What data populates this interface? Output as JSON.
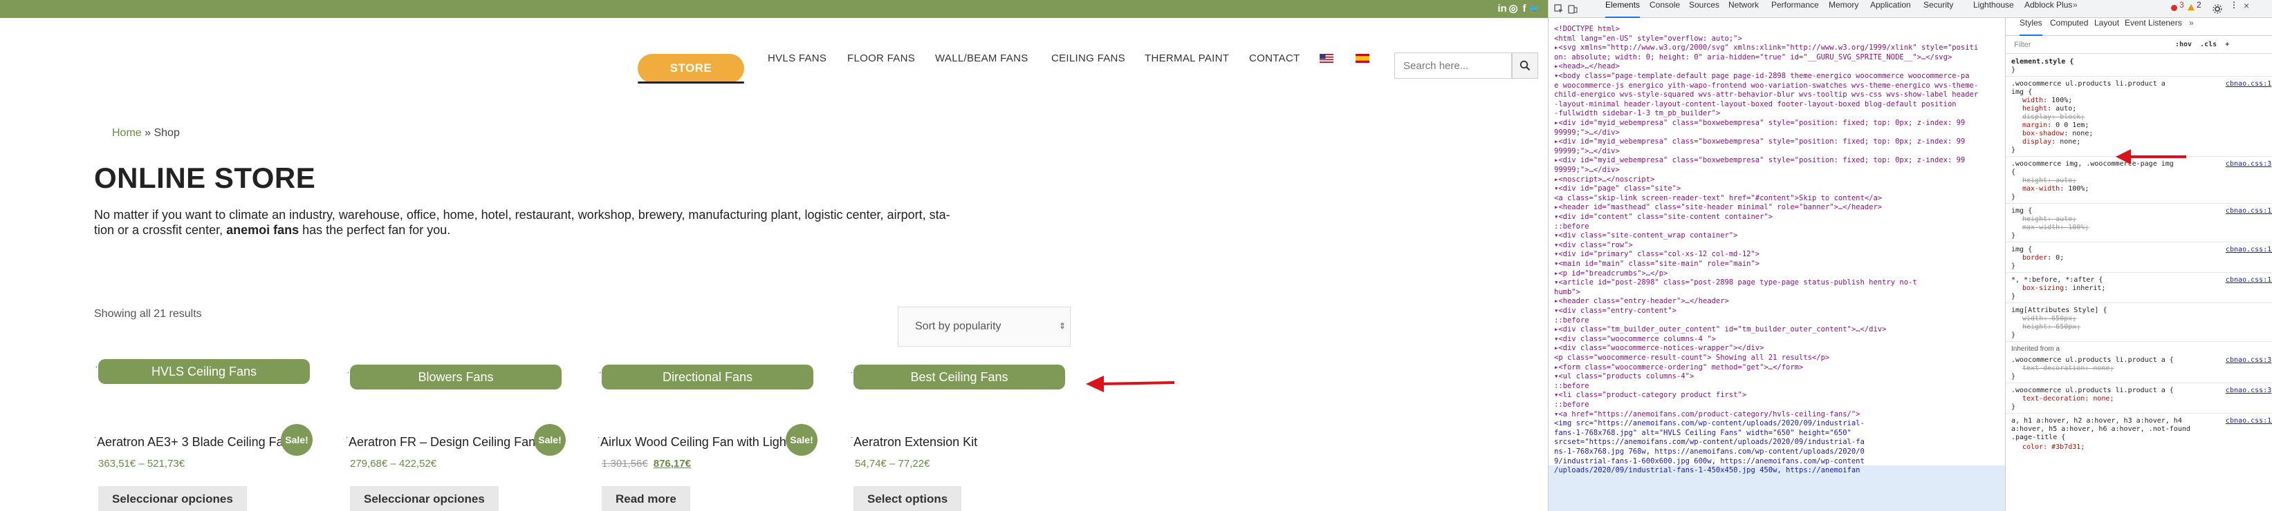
{
  "site": {
    "social": [
      "in",
      "◎",
      "f",
      "🐦"
    ],
    "nav": {
      "store": "STORE",
      "items": [
        "HVLS FANS",
        "FLOOR FANS",
        "WALL/BEAM FANS",
        "CEILING FANS",
        "THERMAL PAINT",
        "CONTACT"
      ],
      "search_placeholder": "Search here..."
    },
    "breadcrumb": {
      "home": "Home",
      "sep": " » ",
      "current": "Shop"
    },
    "title": "ONLINE STORE",
    "intro_1": "No matter if you want to climate an industry, warehouse, office, home, hotel, restaurant, workshop, brewery, manufacturing plant, logistic center, airport, sta-",
    "intro_2a": "tion or a crossfit center, ",
    "intro_brand": "anemoi fans",
    "intro_2b": " has the perfect fan for you.",
    "result_count": "Showing all 21 results",
    "sort": "Sort by popularity",
    "categories": [
      "HVLS Ceiling Fans",
      "Blowers Fans",
      "Directional Fans",
      "Best Ceiling Fans"
    ],
    "products": [
      {
        "name": "Aeratron AE3+ 3 Blade Ceiling Fan",
        "sale": "Sale!",
        "price": "363,51€ – 521,73€",
        "button": "Seleccionar opciones"
      },
      {
        "name": "Aeratron FR – Design Ceiling Fan",
        "sale": "Sale!",
        "price": "279,68€ – 422,52€",
        "button": "Seleccionar opciones"
      },
      {
        "name": "Airlux Wood Ceiling Fan with Light",
        "sale": "Sale!",
        "old_price": "1.301,56€",
        "price": "876,17€",
        "button": "Read more"
      },
      {
        "name": "Aeratron Extension Kit",
        "price": "54,74€ – 77,22€",
        "button": "Select options"
      }
    ]
  },
  "devtools": {
    "tabs": [
      "Elements",
      "Console",
      "Sources",
      "Network",
      "Performance",
      "Memory",
      "Application",
      "Security",
      "Lighthouse",
      "Adblock Plus"
    ],
    "badges": {
      "errors": "3",
      "warnings": "2"
    },
    "elements": [
      "<!DOCTYPE html>",
      "<html lang=\"en-US\" style=\"overflow: auto;\">",
      "▸<svg xmlns=\"http://www.w3.org/2000/svg\" xmlns:xlink=\"http://www.w3.org/1999/xlink\" style=\"positi",
      "on: absolute; width: 0; height: 0\" aria-hidden=\"true\" id=\"__GURU_SVG_SPRITE_NODE__\">…</svg>",
      "▸<head>…</head>",
      "▾<body class=\"page-template-default page page-id-2898 theme-energico woocommerce woocommerce-pa",
      "e woocommerce-js energico yith-wapo-frontend woo-variation-swatches wvs-theme-energico wvs-theme-",
      "child-energico wvs-style-squared wvs-attr-behavior-blur wvs-tooltip wvs-css wvs-show-label header",
      "-layout-minimal header-layout-content-layout-boxed footer-layout-boxed blog-default position",
      "-fullwidth sidebar-1-3 tm_pb_builder\">",
      " ▸<div id=\"myid_webempresa\" class=\"boxwebempresa\" style=\"position: fixed; top: 0px; z-index: 99",
      "  99999;\">…</div>",
      " ▸<div id=\"myid_webempresa\" class=\"boxwebempresa\" style=\"position: fixed; top: 0px; z-index: 99",
      "  99999;\">…</div>",
      " ▸<div id=\"myid_webempresa\" class=\"boxwebempresa\" style=\"position: fixed; top: 0px; z-index: 99",
      "  99999;\">…</div>",
      " ▸<noscript>…</noscript>",
      " ▾<div id=\"page\" class=\"site\">",
      "    <a class=\"skip-link screen-reader-text\" href=\"#content\">Skip to content</a>",
      "   ▸<header id=\"masthead\" class=\"site-header minimal\" role=\"banner\">…</header>",
      "   ▾<div id=\"content\" class=\"site-content container\">",
      "      ::before",
      "     ▾<div class=\"site-content_wrap container\">",
      "       ▾<div class=\"row\">",
      "         ▾<div id=\"primary\" class=\"col-xs-12 col-md-12\">",
      "           ▾<main id=\"main\" class=\"site-main\" role=\"main\">",
      "             ▸<p id=\"breadcrumbs\">…</p>",
      "             ▾<article id=\"post-2898\" class=\"post-2898 page type-page status-publish hentry no-t",
      "               humb\">",
      "               ▸<header class=\"entry-header\">…</header>",
      "               ▾<div class=\"entry-content\">",
      "                  ::before",
      "                 ▸<div class=\"tm_builder_outer_content\" id=\"tm_builder_outer_content\">…</div>",
      "                 ▾<div class=\"woocommerce columns-4 \">",
      "                   ▸<div class=\"woocommerce-notices-wrapper\"></div>",
      "                    <p class=\"woocommerce-result-count\"> Showing all 21 results</p>",
      "                   ▸<form class=\"woocommerce-ordering\" method=\"get\">…</form>",
      "                   ▾<ul class=\"products columns-4\">",
      "                      ::before",
      "                     ▾<li class=\"product-category product first\">",
      "                        ::before",
      "                       ▾<a href=\"https://anemoifans.com/product-category/hvls-ceiling-fans/\">",
      "                          <img src=\"https://anemoifans.com/wp-content/uploads/2020/09/industrial-",
      "                          fans-1-768x768.jpg\" alt=\"HVLS Ceiling Fans\" width=\"650\" height=\"650\"",
      "                          srcset=\"https://anemoifans.com/wp-content/uploads/2020/09/industrial-fa",
      "                          ns-1-768x768.jpg 768w, https://anemoifans.com/wp-content/uploads/2020/0",
      "                          9/industrial-fans-1-600x600.jpg 600w, https://anemoifans.com/wp-content",
      "                          /uploads/2020/09/industrial-fans-1-450x450.jpg 450w, https://anemoifan"
    ],
    "styles_tabs": [
      "Styles",
      "Computed",
      "Layout",
      "Event Listeners"
    ],
    "filter": "Filter",
    "filter_tools": ":hov  .cls  +",
    "styles": [
      {
        "sel": "element.style {",
        "props": [],
        "src": ""
      },
      {
        "sel": ".woocommerce ul.products li.product a",
        "sel2": "img {",
        "src": "cbnao.css:1",
        "props": [
          {
            "p": "width",
            "v": "100%;"
          },
          {
            "p": "height",
            "v": "auto;"
          },
          {
            "p": "display",
            "v": "block;",
            "s": true
          },
          {
            "p": "margin",
            "v": "0 0 1em;"
          },
          {
            "p": "box-shadow",
            "v": "none;"
          },
          {
            "p": "display",
            "v": "none;"
          }
        ]
      },
      {
        "sel": ".woocommerce img, .woocommerce-page img",
        "sel2": "{",
        "src": "cbnao.css:3",
        "props": [
          {
            "p": "height",
            "v": "auto;",
            "s": true
          },
          {
            "p": "max-width",
            "v": "100%;"
          }
        ]
      },
      {
        "sel": "img {",
        "src": "cbnao.css:142",
        "props": [
          {
            "p": "height",
            "v": "auto;",
            "s": true
          },
          {
            "p": "max-width",
            "v": "100%;",
            "s": true
          }
        ]
      },
      {
        "sel": "img {",
        "src": "cbnao.css:142",
        "props": [
          {
            "p": "border",
            "v": "0;"
          }
        ]
      },
      {
        "sel": "*, *:before, *:after {",
        "src": "cbnao.css:142",
        "props": [
          {
            "p": "box-sizing",
            "v": "inherit;"
          }
        ]
      },
      {
        "sel": "img[Attributes Style] {",
        "src": "",
        "props": [
          {
            "p": "width",
            "v": "650px;",
            "s": true
          },
          {
            "p": "height",
            "v": "650px;",
            "s": true
          }
        ]
      }
    ],
    "inherited": "Inherited from a",
    "inherited_rules": [
      {
        "sel": ".woocommerce ul.products li.product a {",
        "src": "cbnao.css:3",
        "props": [
          {
            "p": "text-decoration",
            "v": "none;",
            "s": true
          }
        ]
      },
      {
        "sel": ".woocommerce ul.products li.product a {",
        "src": "cbnao.css:3",
        "props": [
          {
            "p": "text-decoration",
            "v": "none;"
          }
        ]
      }
    ],
    "last_rule": "a, h1 a:hover, h2 a:hover, h3 a:hover, h4 a:hover, h5 a:hover, h6 a:hover, .not-found .page-title {",
    "last_src": "cbnao.css:142",
    "last_prop": "color: #3b7d31;"
  }
}
